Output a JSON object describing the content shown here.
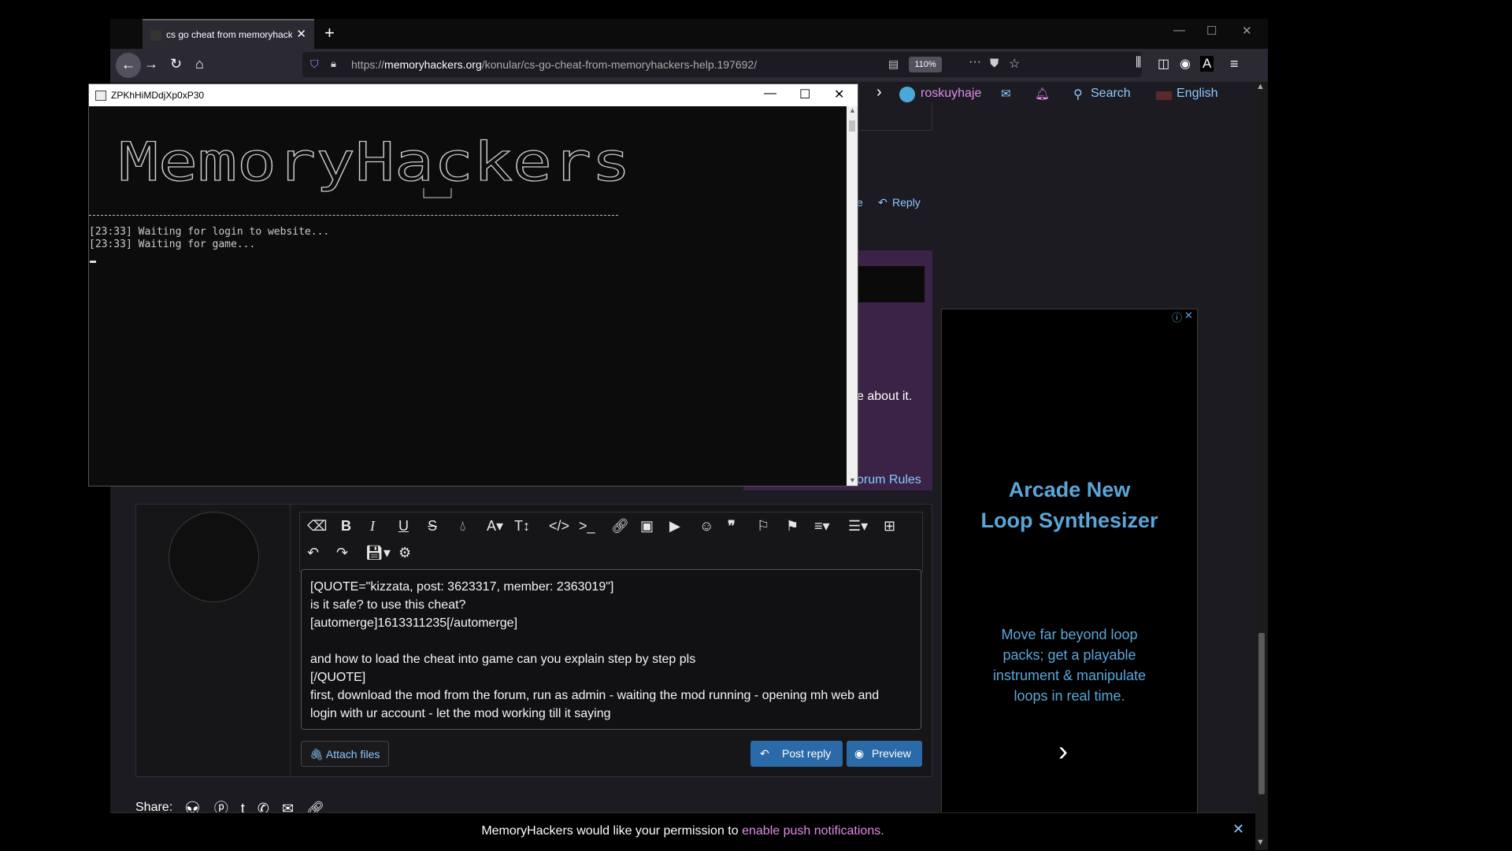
{
  "browser": {
    "tab_title": "cs go cheat from memoryhack",
    "url_prefix": "https://",
    "url_host": "memoryhackers.org",
    "url_path": "/konular/cs-go-cheat-from-memoryhackers-help.197692/",
    "zoom": "110%"
  },
  "site_nav": {
    "username": "roskuyhaje",
    "search_label": "Search",
    "language_label": "English"
  },
  "post_actions": {
    "reply_label": "Reply",
    "partial_like": "e",
    "partial_text": "e about it.",
    "forum_rules_link": "orum Rules"
  },
  "editor": {
    "lines": [
      "[QUOTE=\"kizzata, post: 3623317, member: 2363019\"]",
      "is it safe? to use this cheat?",
      "[automerge]1613311235[/automerge]",
      "",
      "and how to load the cheat into game can you explain step by step pls",
      "[/QUOTE]",
      "first, download the mod from the forum, run as admin - waiting the mod running - opening mh web and",
      "login with ur account - let the mod working till it saying"
    ],
    "attach_label": "Attach files",
    "post_reply_label": "Post reply",
    "preview_label": "Preview"
  },
  "share": {
    "label": "Share:"
  },
  "ad": {
    "title_line1": "Arcade New",
    "title_line2": "Loop Synthesizer",
    "body": "Move far beyond loop packs; get a playable instrument & manipulate loops in real time."
  },
  "notification": {
    "text": "MemoryHackers would like your permission to ",
    "link": "enable push notifications."
  },
  "console": {
    "title": "ZPKhHiMDdjXp0xP30",
    "log_line1": "[23:33] Waiting for login to website...",
    "log_line2": "[23:33] Waiting for game..."
  }
}
